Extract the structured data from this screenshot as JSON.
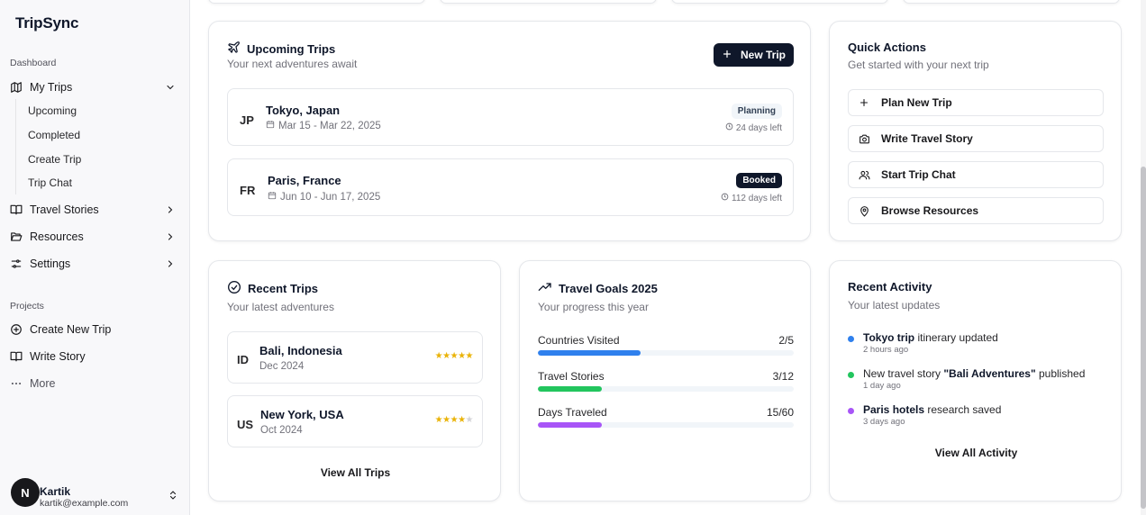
{
  "app": {
    "name": "TripSync"
  },
  "sidebar": {
    "dashboard_label": "Dashboard",
    "my_trips": "My Trips",
    "sub_items": [
      "Upcoming",
      "Completed",
      "Create Trip",
      "Trip Chat"
    ],
    "travel_stories": "Travel Stories",
    "resources": "Resources",
    "settings": "Settings",
    "projects_label": "Projects",
    "create_new_trip": "Create New Trip",
    "write_story": "Write Story",
    "more": "More",
    "user": {
      "initial": "N",
      "name": "Kartik",
      "email": "kartik@example.com"
    }
  },
  "upcoming": {
    "title": "Upcoming Trips",
    "subtitle": "Your next adventures await",
    "new_trip_label": "New Trip",
    "trips": [
      {
        "code": "JP",
        "name": "Tokyo, Japan",
        "dates": "Mar 15 - Mar 22, 2025",
        "status": "Planning",
        "days_left": "24 days left"
      },
      {
        "code": "FR",
        "name": "Paris, France",
        "dates": "Jun 10 - Jun 17, 2025",
        "status": "Booked",
        "days_left": "112 days left"
      }
    ]
  },
  "quick_actions": {
    "title": "Quick Actions",
    "subtitle": "Get started with your next trip",
    "actions": [
      {
        "label": "Plan New Trip",
        "icon": "plus-icon"
      },
      {
        "label": "Write Travel Story",
        "icon": "camera-icon"
      },
      {
        "label": "Start Trip Chat",
        "icon": "users-icon"
      },
      {
        "label": "Browse Resources",
        "icon": "map-pin-icon"
      }
    ]
  },
  "recent_trips": {
    "title": "Recent Trips",
    "subtitle": "Your latest adventures",
    "trips": [
      {
        "code": "ID",
        "name": "Bali, Indonesia",
        "date": "Dec 2024",
        "rating": 5
      },
      {
        "code": "US",
        "name": "New York, USA",
        "date": "Oct 2024",
        "rating": 4
      }
    ],
    "view_all": "View All Trips"
  },
  "goals": {
    "title": "Travel Goals 2025",
    "subtitle": "Your progress this year",
    "items": [
      {
        "label": "Countries Visited",
        "value": "2/5",
        "progress": 0.4,
        "color": "#2f80ed"
      },
      {
        "label": "Travel Stories",
        "value": "3/12",
        "progress": 0.25,
        "color": "#22c55e"
      },
      {
        "label": "Days Traveled",
        "value": "15/60",
        "progress": 0.25,
        "color": "#a855f7"
      }
    ]
  },
  "activity": {
    "title": "Recent Activity",
    "subtitle": "Your latest updates",
    "items": [
      {
        "bold": "Tokyo trip",
        "text": " itinerary updated",
        "time": "2 hours ago",
        "color": "#2f80ed"
      },
      {
        "pre": "New travel story ",
        "bold": "\"Bali Adventures\"",
        "text": " published",
        "time": "1 day ago",
        "color": "#22c55e"
      },
      {
        "bold": "Paris hotels",
        "text": " research saved",
        "time": "3 days ago",
        "color": "#a855f7"
      }
    ],
    "view_all": "View All Activity"
  }
}
